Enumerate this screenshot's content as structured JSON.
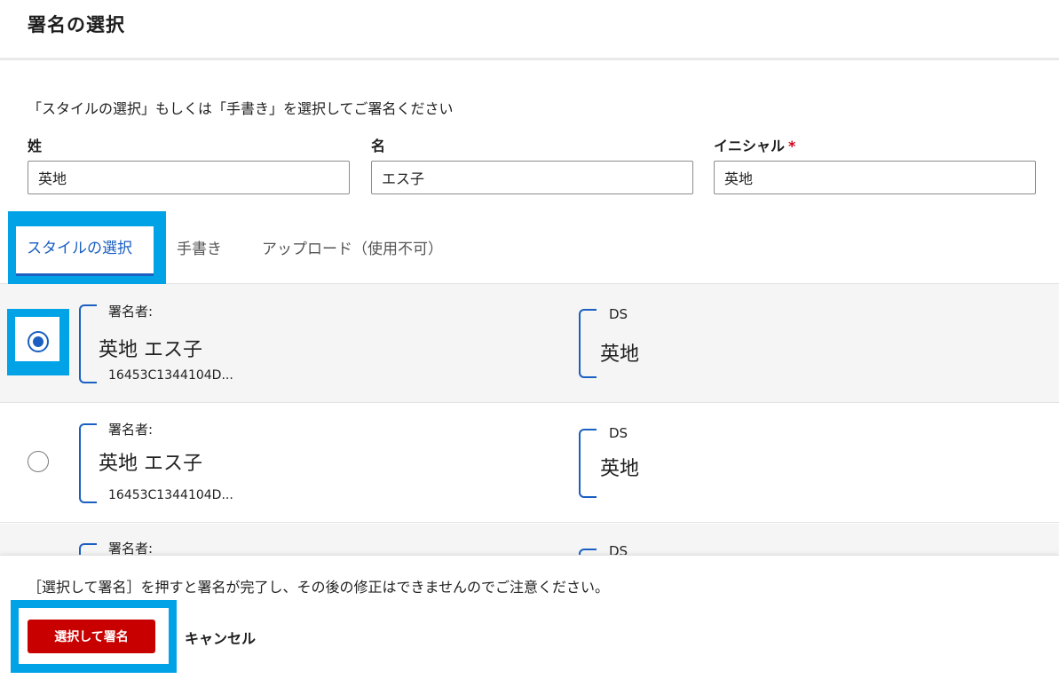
{
  "header": {
    "title": "署名の選択"
  },
  "instruction": "「スタイルの選択」もしくは「手書き」を選択してご署名ください",
  "fields": {
    "last_name": {
      "label": "姓",
      "value": "英地"
    },
    "first_name": {
      "label": "名",
      "value": "エス子"
    },
    "initials": {
      "label": "イニシャル",
      "required_mark": "*",
      "value": "英地"
    }
  },
  "tabs": [
    {
      "label": "スタイルの選択",
      "active": true
    },
    {
      "label": "手書き",
      "active": false
    },
    {
      "label": "アップロード（使用不可）",
      "active": false
    }
  ],
  "signature_options": [
    {
      "selected": true,
      "signer_label": "署名者:",
      "signature": "英地 エス子",
      "id": "16453C1344104D...",
      "initials_label": "DS",
      "initials": "英地"
    },
    {
      "selected": false,
      "signer_label": "署名者:",
      "signature": "英地  エス子",
      "id": "16453C1344104D...",
      "initials_label": "DS",
      "initials": "英地"
    },
    {
      "selected": false,
      "signer_label": "署名者:",
      "signature": "",
      "id": "",
      "initials_label": "DS",
      "initials": ""
    }
  ],
  "footer": {
    "notice": "［選択して署名］を押すと署名が完了し、その後の修正はできませんのでご注意ください。",
    "submit_label": "選択して署名",
    "cancel_label": "キャンセル"
  },
  "colors": {
    "accent": "#1a5fc1",
    "primary_button": "#c80000",
    "highlight": "#01a2e6"
  }
}
